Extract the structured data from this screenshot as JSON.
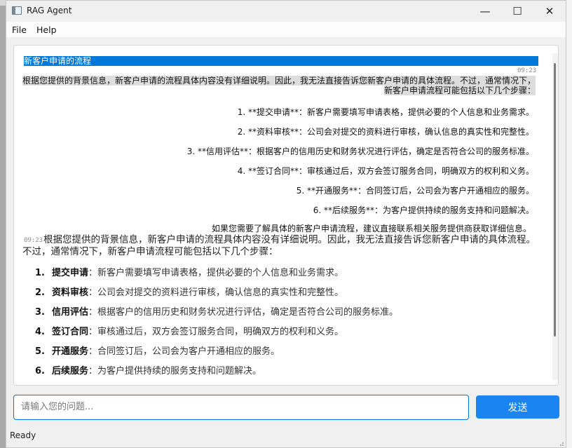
{
  "window": {
    "title": "RAG Agent",
    "minimize_glyph": "—",
    "maximize_glyph": "☐",
    "close_glyph": "✕"
  },
  "menu": {
    "file": "File",
    "help": "Help"
  },
  "chat": {
    "question": "新客户申请的流程",
    "question_time": "09:23",
    "raw_answer": {
      "intro": "根据您提供的背景信息，新客户申请的流程具体内容没有详细说明。因此，我无法直接告诉您新客户申请的具体流程。不过，通常情况下，新客户申请流程可能包括以下几个步骤：",
      "items": [
        "1. **提交申请**：新客户需要填写申请表格，提供必要的个人信息和业务需求。",
        "2. **资料审核**：公司会对提交的资料进行审核，确认信息的真实性和完整性。",
        "3. **信用评估**：根据客户的信用历史和财务状况进行评估，确定是否符合公司的服务标准。",
        "4. **签订合同**：审核通过后，双方会签订服务合同，明确双方的权利和义务。",
        "5. **开通服务**：合同签订后，公司会为客户开通相应的服务。",
        "6. **后续服务**：为客户提供持续的服务支持和问题解决。"
      ],
      "closing": "如果您需要了解具体的新客户申请流程，建议直接联系相关服务提供商获取详细信息。"
    },
    "answer_time": "09:23",
    "rendered_answer": {
      "intro": "根据您提供的背景信息，新客户申请的流程具体内容没有详细说明。因此，我无法直接告诉您新客户申请的具体流程。不过，通常情况下，新客户申请流程可能包括以下几个步骤：",
      "items": [
        {
          "num": "1.",
          "title": "提交申请",
          "text": "：新客户需要填写申请表格，提供必要的个人信息和业务需求。"
        },
        {
          "num": "2.",
          "title": "资料审核",
          "text": "：公司会对提交的资料进行审核，确认信息的真实性和完整性。"
        },
        {
          "num": "3.",
          "title": "信用评估",
          "text": "：根据客户的信用历史和财务状况进行评估，确定是否符合公司的服务标准。"
        },
        {
          "num": "4.",
          "title": "签订合同",
          "text": "：审核通过后，双方会签订服务合同，明确双方的权利和义务。"
        },
        {
          "num": "5.",
          "title": "开通服务",
          "text": "：合同签订后，公司会为客户开通相应的服务。"
        },
        {
          "num": "6.",
          "title": "后续服务",
          "text": "：为客户提供持续的服务支持和问题解决。"
        }
      ]
    }
  },
  "input": {
    "placeholder": "请输入您的问题..."
  },
  "send_button": "发送",
  "status": "Ready",
  "colors": {
    "accent": "#0078d7",
    "send_button": "#1a84f0"
  }
}
